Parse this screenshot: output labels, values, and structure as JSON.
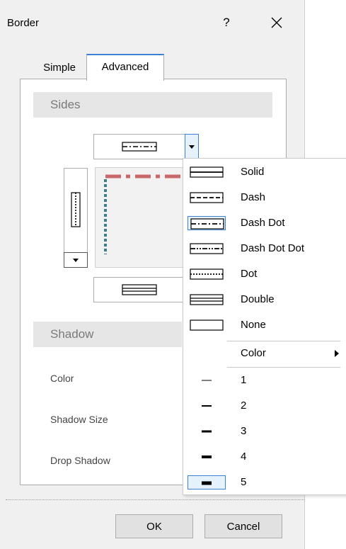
{
  "dialog": {
    "title": "Border",
    "help_label": "?",
    "tabs": [
      {
        "label": "Simple"
      },
      {
        "label": "Advanced"
      }
    ],
    "sections": {
      "sides": "Sides",
      "shadow": "Shadow"
    },
    "shadow_props": [
      "Color",
      "Shadow Size",
      "Drop Shadow"
    ],
    "buttons": {
      "ok": "OK",
      "cancel": "Cancel"
    },
    "preview_colors": {
      "top": "#c9686a",
      "left": "#3a7f8c"
    }
  },
  "menu": {
    "styles": [
      {
        "label": "Solid",
        "style": "solid"
      },
      {
        "label": "Dash",
        "style": "dash"
      },
      {
        "label": "Dash Dot",
        "style": "dashdot",
        "selected": true
      },
      {
        "label": "Dash Dot Dot",
        "style": "dashdotdot"
      },
      {
        "label": "Dot",
        "style": "dot"
      },
      {
        "label": "Double",
        "style": "double"
      },
      {
        "label": "None",
        "style": "none"
      }
    ],
    "color_label": "Color",
    "widths": [
      {
        "label": "1"
      },
      {
        "label": "2"
      },
      {
        "label": "3"
      },
      {
        "label": "4"
      },
      {
        "label": "5",
        "selected": true
      }
    ]
  }
}
